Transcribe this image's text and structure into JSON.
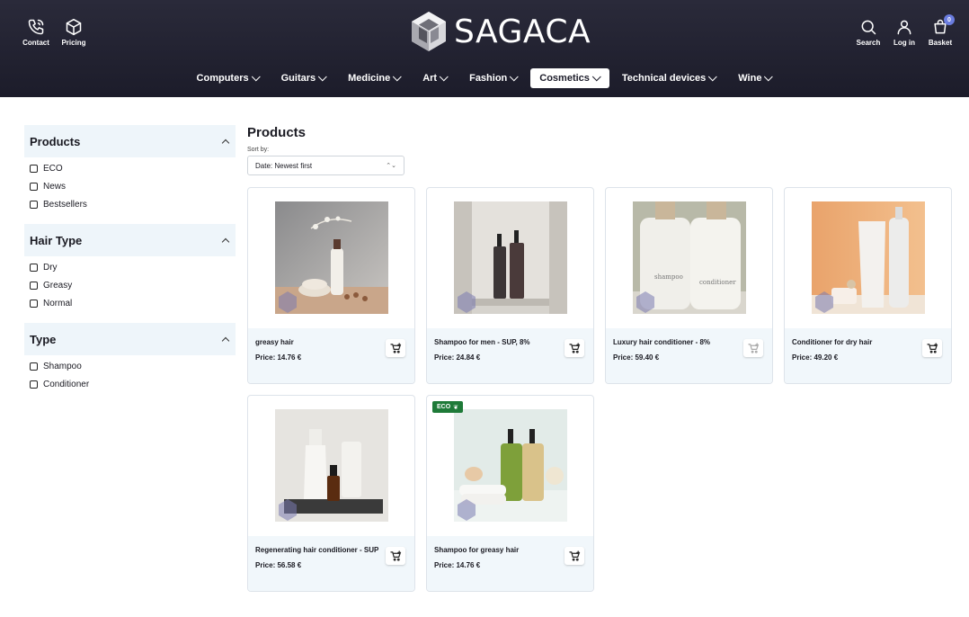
{
  "header": {
    "left_buttons": [
      {
        "label": "Contact",
        "icon": "phone-icon"
      },
      {
        "label": "Pricing",
        "icon": "box-icon"
      }
    ],
    "logo_text": "SAGACA",
    "right_buttons": [
      {
        "label": "Search",
        "icon": "search-icon"
      },
      {
        "label": "Log in",
        "icon": "user-icon"
      },
      {
        "label": "Basket",
        "icon": "basket-icon",
        "count": "0"
      }
    ]
  },
  "nav": [
    {
      "label": "Computers"
    },
    {
      "label": "Guitars"
    },
    {
      "label": "Medicine"
    },
    {
      "label": "Art"
    },
    {
      "label": "Fashion"
    },
    {
      "label": "Cosmetics",
      "active": true
    },
    {
      "label": "Technical devices"
    },
    {
      "label": "Wine"
    }
  ],
  "sidebar": {
    "groups": [
      {
        "title": "Products",
        "options": [
          "ECO",
          "News",
          "Bestsellers"
        ]
      },
      {
        "title": "Hair Type",
        "options": [
          "Dry",
          "Greasy",
          "Normal"
        ]
      },
      {
        "title": "Type",
        "options": [
          "Shampoo",
          "Conditioner"
        ]
      }
    ]
  },
  "main": {
    "title": "Products",
    "sort_label": "Sort by:",
    "sort_value": "Date: Newest first"
  },
  "products": [
    {
      "name": "greasy hair",
      "price": "Price: 14.76 €"
    },
    {
      "name": "Shampoo for men - SUP, 8%",
      "price": "Price: 24.84 €"
    },
    {
      "name": "Luxury hair conditioner - 8%",
      "price": "Price: 59.40 €"
    },
    {
      "name": "Conditioner for dry hair",
      "price": "Price: 49.20 €"
    },
    {
      "name": "Regenerating hair conditioner - SUP",
      "price": "Price: 56.58 €"
    },
    {
      "name": "Shampoo for greasy hair",
      "price": "Price: 14.76 €",
      "badge": "ECO"
    }
  ],
  "colors": {
    "header_bg": "#1c1c2a",
    "filter_bg": "#eef5fa",
    "card_info_bg": "#f1f7fb",
    "eco_badge": "#1e7a38",
    "basket_badge": "#6b7de0"
  }
}
